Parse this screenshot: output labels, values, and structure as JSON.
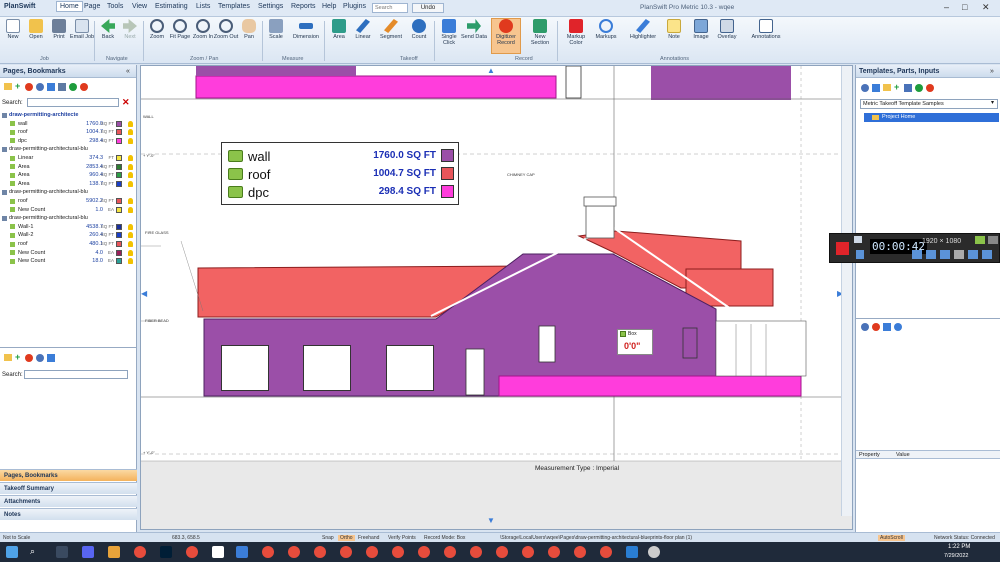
{
  "app": {
    "name": "PlanSwift",
    "title": "PlanSwift Pro Metric 10.3 - wqee",
    "menus": [
      "Home",
      "Page",
      "Tools",
      "View",
      "Estimating",
      "Lists",
      "Templates",
      "Settings",
      "Reports",
      "Help",
      "Plugins"
    ],
    "search_label": "Search",
    "undo_label": "Undo"
  },
  "ribbon": {
    "buttons": [
      {
        "label": "New",
        "icon": "new-icon"
      },
      {
        "label": "Open",
        "icon": "open-icon"
      },
      {
        "label": "Print",
        "icon": "print-icon"
      },
      {
        "label": "Email Job",
        "icon": "email-icon"
      },
      {
        "label": "Back",
        "icon": "back-icon"
      },
      {
        "label": "Next",
        "icon": "next-icon"
      },
      {
        "label": "Zoom",
        "icon": "zoom-icon"
      },
      {
        "label": "Fit Page",
        "icon": "fit-page-icon"
      },
      {
        "label": "Zoom In",
        "icon": "zoom-in-icon"
      },
      {
        "label": "Zoom Out",
        "icon": "zoom-out-icon"
      },
      {
        "label": "Pan",
        "icon": "pan-icon"
      },
      {
        "label": "Scale",
        "icon": "scale-icon"
      },
      {
        "label": "Dimension",
        "icon": "dimension-icon"
      },
      {
        "label": "Area",
        "icon": "area-icon"
      },
      {
        "label": "Linear",
        "icon": "linear-icon"
      },
      {
        "label": "Segment",
        "icon": "segment-icon"
      },
      {
        "label": "Count",
        "icon": "count-icon"
      },
      {
        "label": "Single Click",
        "icon": "single-click-icon"
      },
      {
        "label": "Send Data",
        "icon": "send-data-icon"
      },
      {
        "label": "Digitizer Record",
        "icon": "digitizer-icon"
      },
      {
        "label": "New Section",
        "icon": "new-section-icon"
      },
      {
        "label": "Markup Color",
        "icon": "markup-color-icon"
      },
      {
        "label": "Markups",
        "icon": "markups-icon"
      },
      {
        "label": "Highlighter",
        "icon": "highlighter-icon"
      },
      {
        "label": "Note",
        "icon": "note-icon"
      },
      {
        "label": "Image",
        "icon": "image-icon"
      },
      {
        "label": "Overlay",
        "icon": "overlay-icon"
      },
      {
        "label": "Annotations",
        "icon": "annotations-icon"
      }
    ],
    "groups": [
      "Job",
      "Navigate",
      "Zoom / Pan",
      "Measure",
      "Takeoff",
      "Record",
      "Annotations"
    ]
  },
  "left_panel": {
    "title": "Pages, Bookmarks",
    "search_label": "Search:",
    "tree": [
      {
        "label": "draw-permitting-architecte",
        "value": "",
        "unit": "",
        "color": "",
        "level": 0,
        "bold": true
      },
      {
        "label": "wall",
        "value": "1760.0",
        "unit": "SQ FT",
        "color": "#9b4fa8",
        "level": 1
      },
      {
        "label": "roof",
        "value": "1004.7",
        "unit": "SQ FT",
        "color": "#e8555a",
        "level": 1
      },
      {
        "label": "dpc",
        "value": "298.4",
        "unit": "SQ FT",
        "color": "#ff3ddc",
        "level": 1
      },
      {
        "label": "draw-permitting-architectural-blu",
        "value": "",
        "unit": "",
        "color": "",
        "level": 0
      },
      {
        "label": "Linear",
        "value": "374.3",
        "unit": "FT",
        "color": "#f5e642",
        "level": 1
      },
      {
        "label": "Area",
        "value": "2853.4",
        "unit": "SQ FT",
        "color": "#2e7d32",
        "level": 1
      },
      {
        "label": "Area",
        "value": "960.4",
        "unit": "SQ FT",
        "color": "#2c9e47",
        "level": 1
      },
      {
        "label": "Area",
        "value": "138.7",
        "unit": "SQ FT",
        "color": "#1a3fc7",
        "level": 1
      },
      {
        "label": "draw-permitting-architectural-blu",
        "value": "",
        "unit": "",
        "color": "",
        "level": 0
      },
      {
        "label": "roof",
        "value": "5902.2",
        "unit": "SQ FT",
        "color": "#e8555a",
        "level": 1
      },
      {
        "label": "New Count",
        "value": "1.0",
        "unit": "EA",
        "color": "#f5e642",
        "level": 1
      },
      {
        "label": "draw-permitting-architectural-blu",
        "value": "",
        "unit": "",
        "color": "",
        "level": 0
      },
      {
        "label": "Wall-1",
        "value": "4538.7",
        "unit": "SQ FT",
        "color": "#1a2f9a",
        "level": 1
      },
      {
        "label": "Wall-2",
        "value": "260.4",
        "unit": "SQ FT",
        "color": "#1a3fc7",
        "level": 1
      },
      {
        "label": "roof",
        "value": "480.1",
        "unit": "SQ FT",
        "color": "#e8555a",
        "level": 1
      },
      {
        "label": "New Count",
        "value": "4.0",
        "unit": "EA",
        "color": "#9b1f5a",
        "level": 1
      },
      {
        "label": "New Count",
        "value": "18.0",
        "unit": "EA",
        "color": "#2aa198",
        "level": 1
      }
    ],
    "second_search_label": "Search:",
    "bottom_tabs": [
      "Pages, Bookmarks",
      "Takeoff Summary",
      "Attachments",
      "Notes"
    ]
  },
  "canvas": {
    "legend": [
      {
        "name": "wall",
        "value": "1760.0 SQ FT",
        "color": "#9b4fa8"
      },
      {
        "name": "roof",
        "value": "1004.7 SQ FT",
        "color": "#e8555a"
      },
      {
        "name": "dpc",
        "value": "298.4 SQ FT",
        "color": "#ff3ddc"
      }
    ],
    "chimney_label": "CHIMNEY CAP",
    "count_box_label": "Box",
    "count_value": "0'0\"",
    "measurement_type": "Measurement Type : Imperial",
    "elev_labels": [
      "+ Y'-0\"",
      "+ Y'-0\""
    ],
    "side_labels": [
      "WALL",
      "FIRE GLASS",
      "FIBER BEAD"
    ]
  },
  "right_panel": {
    "title": "Templates, Parts, Inputs",
    "dropdown_value": "Metric Takeoff Template Samples",
    "tree_item": "Project Home",
    "property_header": "Property",
    "value_header": "Value"
  },
  "recorder": {
    "time": "00:00:42",
    "resolution": "1920 × 1080"
  },
  "status": {
    "left": "Not to Scale",
    "coords": "683.3, 658.5",
    "snap": "Snap",
    "ortho": "Ortho",
    "freehand": "Freehand",
    "verify_points": "Verify Points",
    "record_mode": "Record Mode: Box",
    "path": "\\Storage\\LocalUsers\\wqee\\Pages\\draw-permitting-architectural-blueprints-floor plan (1)",
    "autoscroll": "AutoScroll",
    "network": "Network Status: Connected"
  },
  "taskbar": {
    "time": "1:22 PM",
    "date": "7/29/2022"
  }
}
